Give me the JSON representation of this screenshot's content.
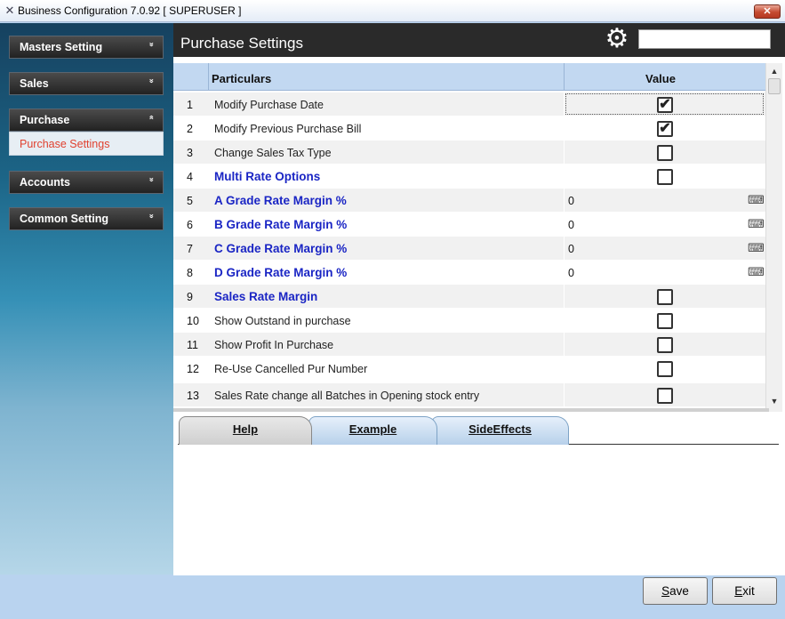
{
  "window": {
    "title": "Business Configuration 7.0.92 [ SUPERUSER ]",
    "close_glyph": "✕"
  },
  "sidebar": {
    "groups": [
      {
        "label": "Masters Setting",
        "chevron": "»",
        "expanded": false
      },
      {
        "label": "Sales",
        "chevron": "»",
        "expanded": false
      },
      {
        "label": "Purchase",
        "chevron": "«",
        "expanded": true
      },
      {
        "label": "Accounts",
        "chevron": "»",
        "expanded": false
      },
      {
        "label": "Common Setting",
        "chevron": "»",
        "expanded": false
      }
    ],
    "purchase_subitems": [
      {
        "label": "Purchase Settings",
        "selected": true
      }
    ]
  },
  "header": {
    "title": "Purchase Settings",
    "search_value": ""
  },
  "grid": {
    "columns": {
      "particulars": "Particulars",
      "value": "Value"
    },
    "rows": [
      {
        "no": "1",
        "name": "Modify Purchase Date",
        "type": "checkbox",
        "checked": true,
        "focused": true,
        "style": "normal"
      },
      {
        "no": "2",
        "name": "Modify Previous Purchase Bill",
        "type": "checkbox",
        "checked": true,
        "style": "normal"
      },
      {
        "no": "3",
        "name": "Change Sales Tax Type",
        "type": "checkbox",
        "checked": false,
        "style": "normal"
      },
      {
        "no": "4",
        "name": "Multi Rate Options",
        "type": "checkbox",
        "checked": false,
        "style": "heading"
      },
      {
        "no": "5",
        "name": "A Grade Rate Margin %",
        "type": "text",
        "value": "0",
        "style": "heading"
      },
      {
        "no": "6",
        "name": "B Grade Rate Margin %",
        "type": "text",
        "value": "0",
        "style": "heading"
      },
      {
        "no": "7",
        "name": "C Grade Rate Margin %",
        "type": "text",
        "value": "0",
        "style": "heading"
      },
      {
        "no": "8",
        "name": "D Grade Rate Margin %",
        "type": "text",
        "value": "0",
        "style": "heading"
      },
      {
        "no": "9",
        "name": "Sales Rate Margin",
        "type": "checkbox",
        "checked": false,
        "style": "heading"
      },
      {
        "no": "10",
        "name": "Show Outstand in purchase",
        "type": "checkbox",
        "checked": false,
        "style": "normal"
      },
      {
        "no": "11",
        "name": "Show Profit In Purchase",
        "type": "checkbox",
        "checked": false,
        "style": "normal"
      },
      {
        "no": "12",
        "name": "Re-Use Cancelled Pur Number",
        "type": "checkbox",
        "checked": false,
        "style": "normal"
      },
      {
        "no": "13",
        "name": "Sales Rate change all Batches in Opening stock entry",
        "type": "checkbox",
        "checked": false,
        "style": "normal"
      }
    ]
  },
  "tabs": [
    {
      "key": "H",
      "rest": "elp",
      "active": true
    },
    {
      "key": "E",
      "rest": "xample",
      "active": false
    },
    {
      "key": "S",
      "rest": "ideEffects",
      "active": false
    }
  ],
  "footer": {
    "save": {
      "key": "S",
      "rest": "ave"
    },
    "exit": {
      "key": "E",
      "rest": "xit"
    }
  },
  "colors": {
    "heading_text": "#1a25c4",
    "selected_subitem_text": "#e0412f",
    "header_bg": "#2a2a2a",
    "grid_header_bg": "#c2d8f1"
  },
  "icons": {
    "gear": "gear-icon",
    "keyboard": "keyboard-icon",
    "check": "✔"
  }
}
